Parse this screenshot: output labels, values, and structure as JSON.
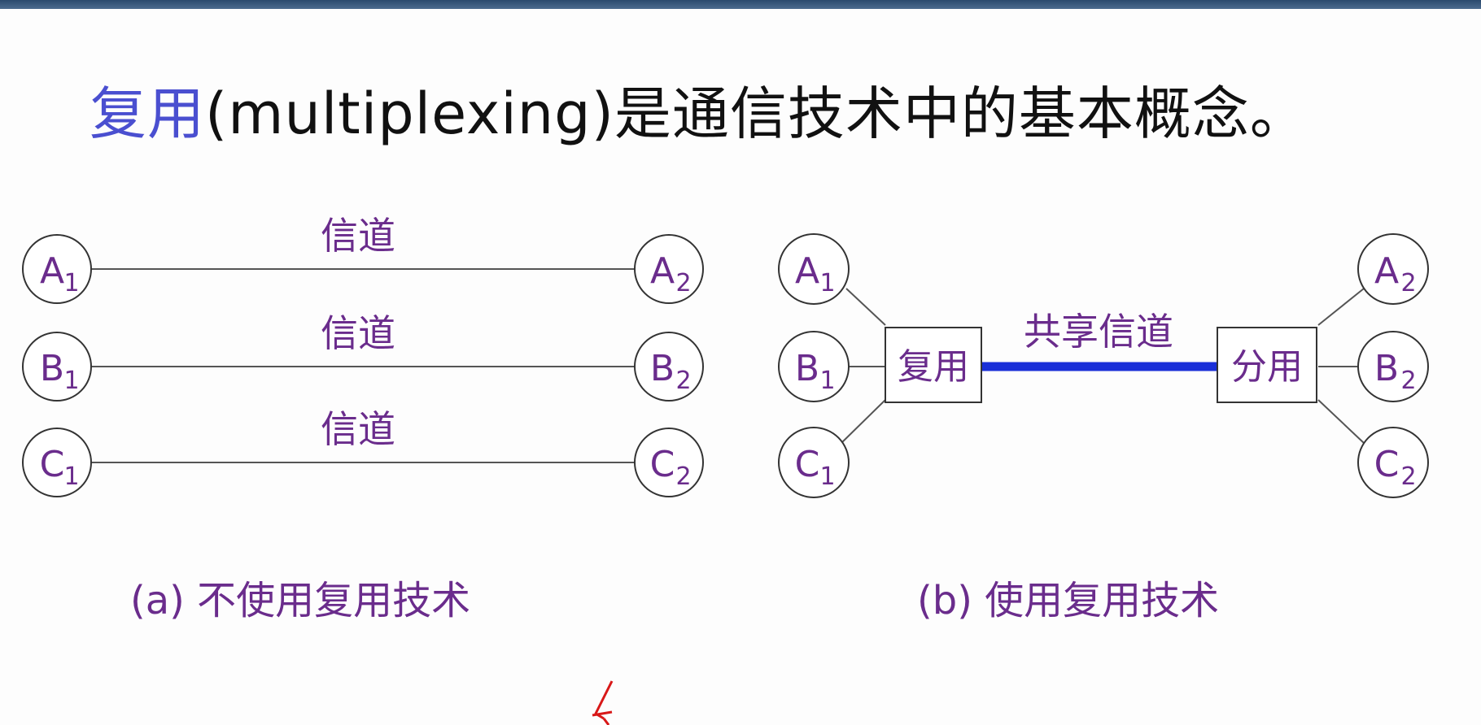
{
  "title": {
    "accent": "复用",
    "rest": "(multiplexing)是通信技术中的基本概念。"
  },
  "colors": {
    "accent": "#4a4fd0",
    "label": "#6a2c8c",
    "shared_channel": "#1a2fd8"
  },
  "diagram_a": {
    "nodes": [
      {
        "main": "A",
        "sub": "1"
      },
      {
        "main": "B",
        "sub": "1"
      },
      {
        "main": "C",
        "sub": "1"
      },
      {
        "main": "A",
        "sub": "2"
      },
      {
        "main": "B",
        "sub": "2"
      },
      {
        "main": "C",
        "sub": "2"
      }
    ],
    "channel_labels": [
      "信道",
      "信道",
      "信道"
    ],
    "caption": "(a)  不使用复用技术"
  },
  "diagram_b": {
    "nodes": [
      {
        "main": "A",
        "sub": "1"
      },
      {
        "main": "B",
        "sub": "1"
      },
      {
        "main": "C",
        "sub": "1"
      },
      {
        "main": "A",
        "sub": "2"
      },
      {
        "main": "B",
        "sub": "2"
      },
      {
        "main": "C",
        "sub": "2"
      }
    ],
    "mux_label": "复用",
    "demux_label": "分用",
    "shared_channel_label": "共享信道",
    "caption": "(b) 使用复用技术"
  }
}
